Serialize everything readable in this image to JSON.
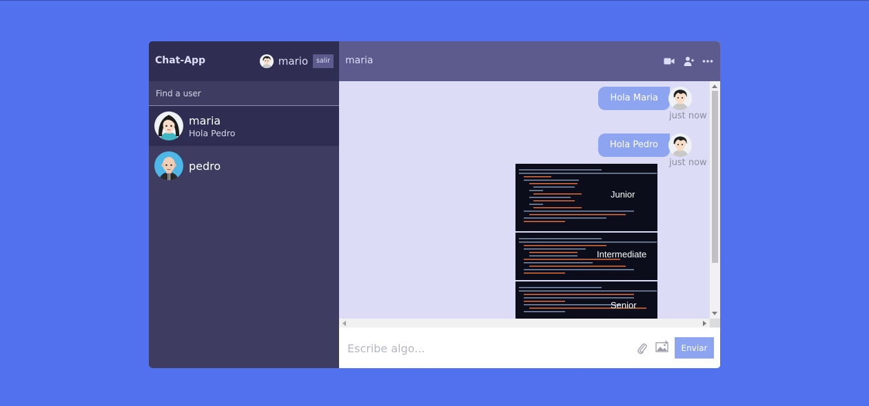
{
  "sidebar": {
    "brand": "Chat-App",
    "current_user": {
      "name": "mario",
      "avatar": "boy-avatar"
    },
    "logout_label": "salir",
    "search_placeholder": "Find a user",
    "users": [
      {
        "name": "maria",
        "last_message": "Hola Pedro",
        "avatar": "girl-avatar",
        "active": true
      },
      {
        "name": "pedro",
        "last_message": "",
        "avatar": "bald-man-avatar",
        "active": false
      }
    ]
  },
  "chat": {
    "title": "maria",
    "header_icons": [
      "video-camera-icon",
      "add-user-icon",
      "more-icon"
    ],
    "messages": [
      {
        "type": "text",
        "text": "Hola Maria",
        "time": "just now",
        "avatar": "boy-avatar"
      },
      {
        "type": "text",
        "text": "Hola Pedro",
        "time": "just now",
        "avatar": "boy-avatar"
      },
      {
        "type": "image",
        "panels": [
          "Junior",
          "Intermediate",
          "Senior"
        ]
      }
    ],
    "composer": {
      "placeholder": "Escribe algo...",
      "attach_icon": "paperclip-icon",
      "image_icon": "image-icon",
      "send_label": "Enviar"
    }
  },
  "colors": {
    "page_bg": "#5271ef",
    "sidebar_bg": "#3e3c61",
    "sidebar_header_bg": "#2f2d52",
    "chat_header_bg": "#5d5b8d",
    "chat_bg": "#dddcf7",
    "bubble": "#8da4f1"
  }
}
